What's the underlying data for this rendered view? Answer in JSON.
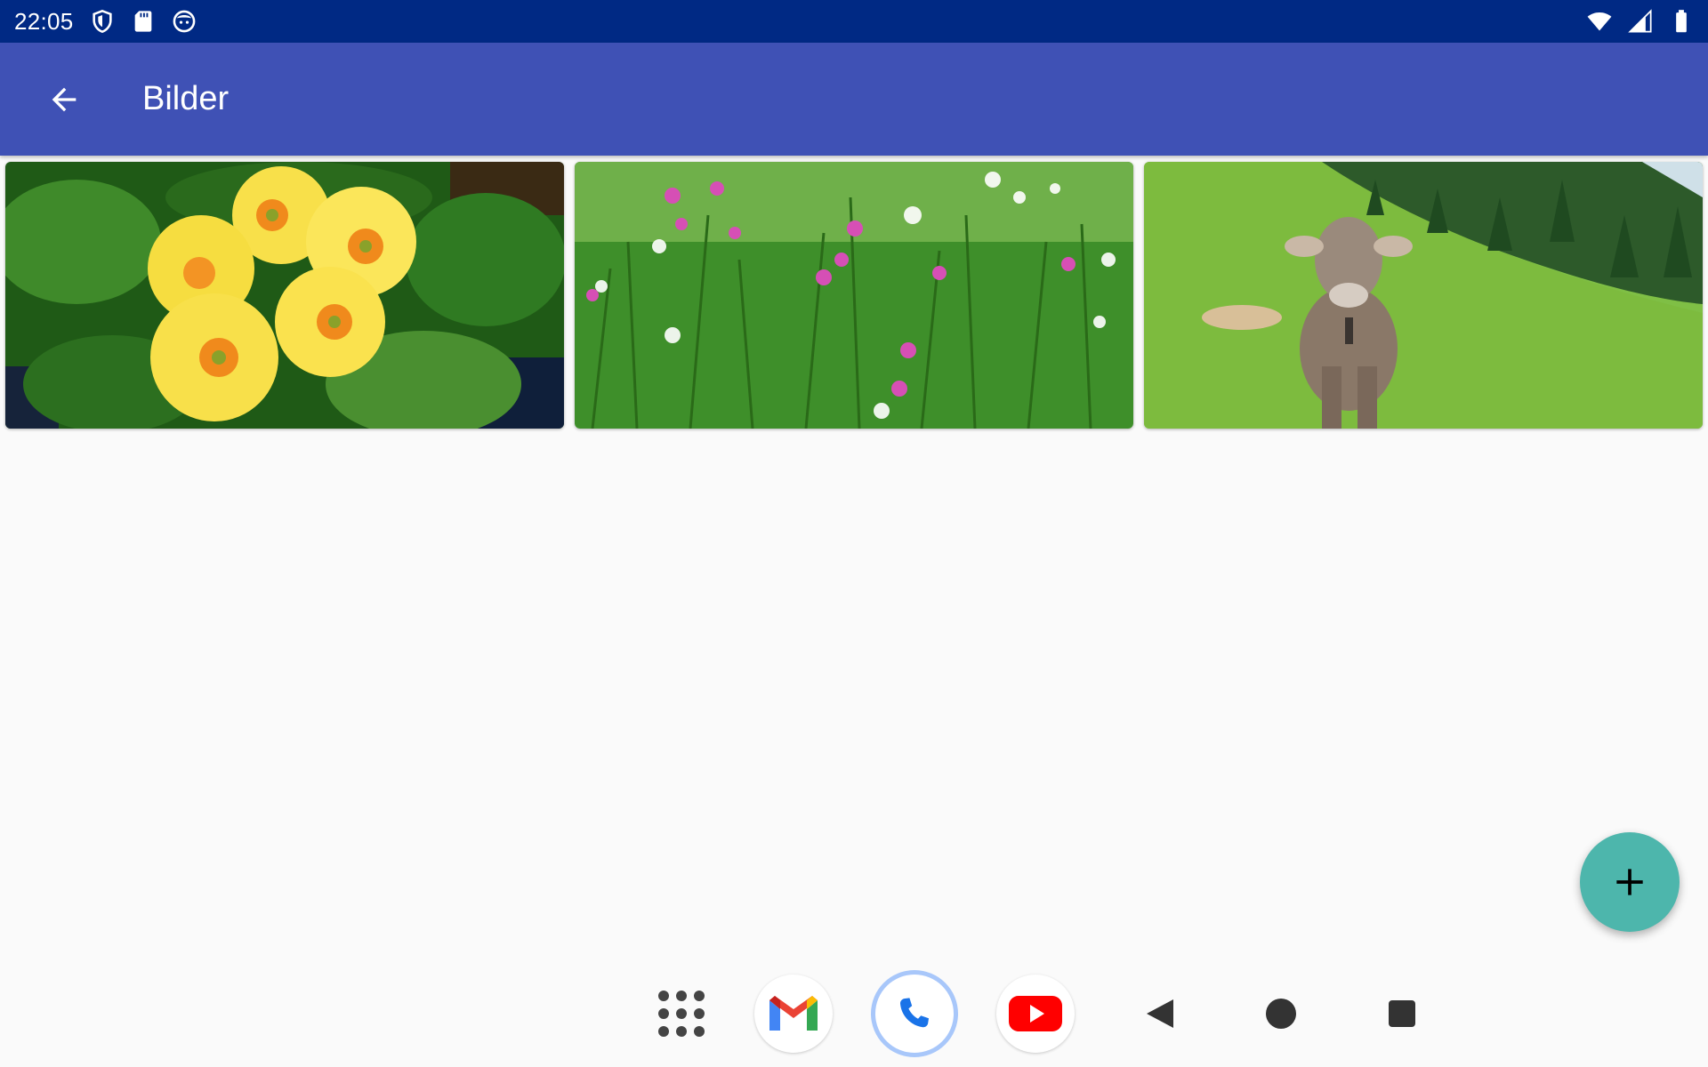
{
  "status_bar": {
    "time": "22:05",
    "left_icons": [
      "shield-icon",
      "sd-card-icon",
      "face-icon"
    ],
    "right_icons": [
      "wifi-icon",
      "cell-signal-icon",
      "battery-icon"
    ],
    "background": "#002984"
  },
  "app_bar": {
    "back_icon": "arrow-back-icon",
    "title": "Bilder",
    "background": "#3F51B5"
  },
  "gallery": {
    "images": [
      {
        "subject": "yellow-primrose-flowers"
      },
      {
        "subject": "meadow-with-pink-wildflowers"
      },
      {
        "subject": "cow-on-alpine-pasture"
      }
    ]
  },
  "fab": {
    "icon": "plus-icon",
    "color": "#4DB6AC"
  },
  "navigation_bar": {
    "apps": [
      "app-drawer-icon",
      "gmail-icon",
      "phone-icon",
      "youtube-icon"
    ],
    "system_buttons": [
      "back-triangle-icon",
      "home-circle-icon",
      "recents-square-icon"
    ]
  }
}
